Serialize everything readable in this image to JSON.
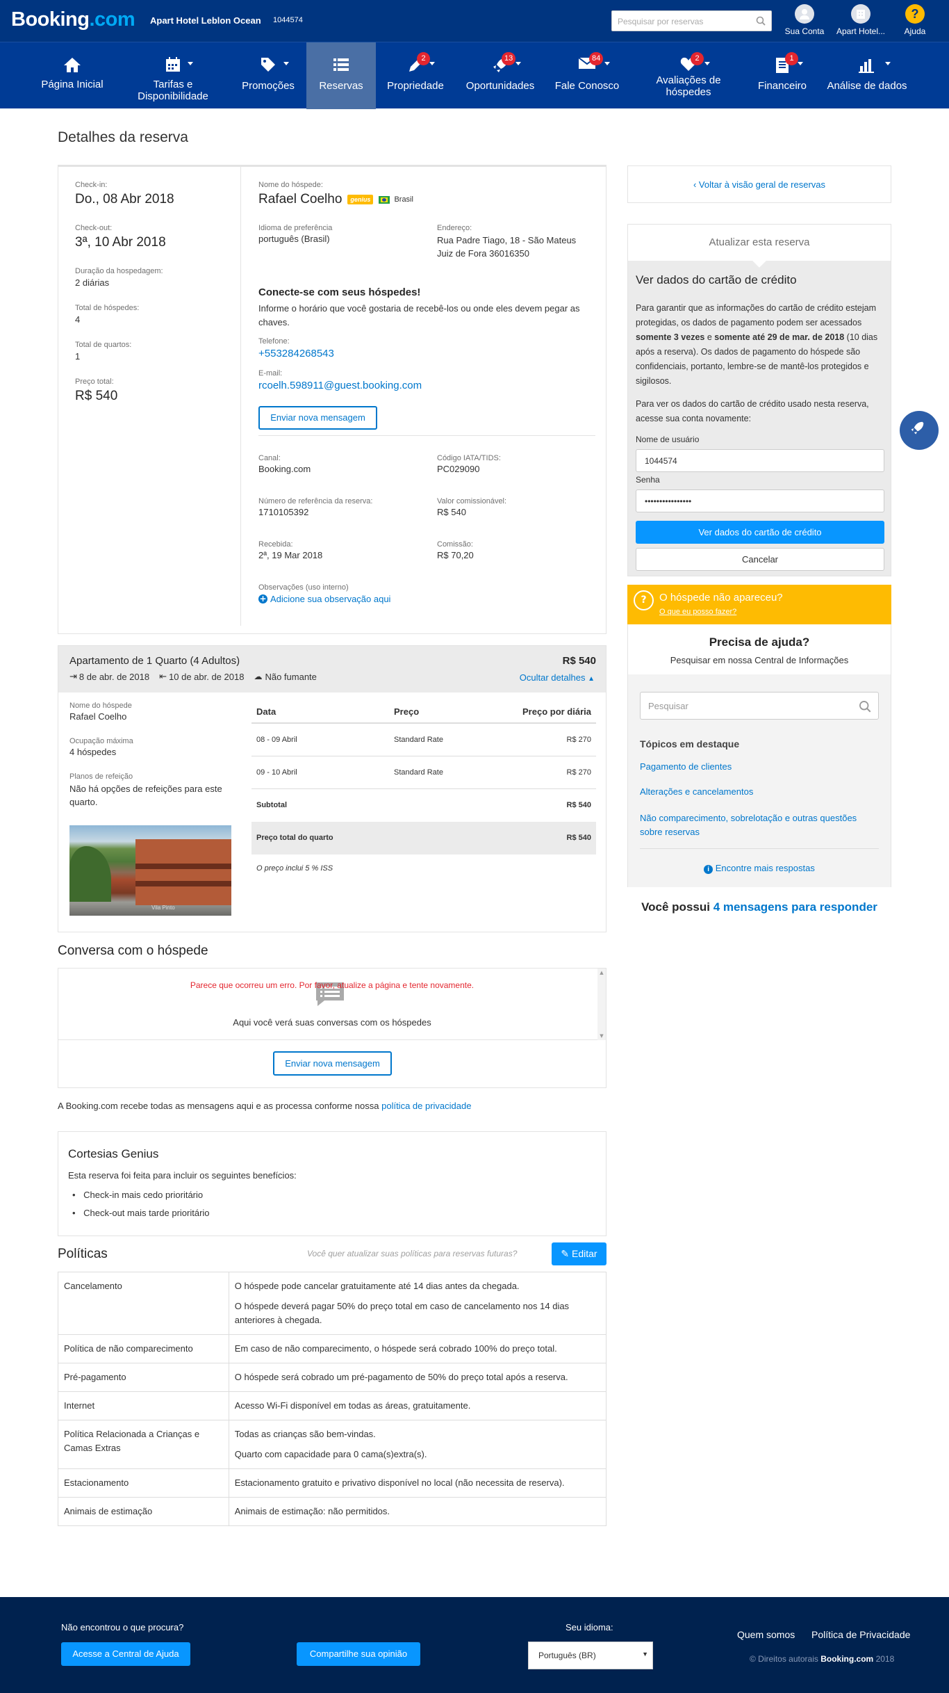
{
  "topbar": {
    "logo_text": "Booking",
    "logo_dot": ".com",
    "hotel_name": "Apart Hotel Leblon Ocean",
    "hotel_id": "1044574",
    "search_placeholder": "Pesquisar por reservas",
    "account_label": "Sua Conta",
    "hotel_label": "Apart Hotel...",
    "help_label": "Ajuda"
  },
  "nav": [
    {
      "label": "Página Inicial",
      "icon": "home-icon"
    },
    {
      "label": "Tarifas e Disponibilidade",
      "icon": "calendar-icon"
    },
    {
      "label": "Promoções",
      "icon": "tag-icon"
    },
    {
      "label": "Reservas",
      "icon": "list-icon"
    },
    {
      "label": "Propriedade",
      "icon": "pencil-icon",
      "badge": "2"
    },
    {
      "label": "Oportunidades",
      "icon": "rocket-icon",
      "badge": "13"
    },
    {
      "label": "Fale Conosco",
      "icon": "mail-icon",
      "badge": "84"
    },
    {
      "label": "Avaliações de hóspedes",
      "icon": "heart-icon",
      "badge": "2"
    },
    {
      "label": "Financeiro",
      "icon": "document-icon",
      "badge": "1"
    },
    {
      "label": "Análise de dados",
      "icon": "bar-chart-icon"
    }
  ],
  "page_title": "Detalhes da reserva",
  "stay": {
    "checkin_label": "Check-in:",
    "checkin": "Do., 08 Abr 2018",
    "checkout_label": "Check-out:",
    "checkout": "3ª, 10 Abr 2018",
    "duration_label": "Duração da hospedagem:",
    "duration": "2 diárias",
    "guests_label": "Total de hóspedes:",
    "guests": "4",
    "rooms_label": "Total de quartos:",
    "rooms": "1",
    "price_label": "Preço total:",
    "price": "R$ 540"
  },
  "guest": {
    "name_label": "Nome do hóspede:",
    "name": "Rafael Coelho",
    "genius": "genius",
    "country": "Brasil",
    "language_label": "Idioma de preferência",
    "language": "português (Brasil)",
    "address_label": "Endereço:",
    "address_line1": "Rua Padre Tiago, 18 - São Mateus",
    "address_line2": "Juiz de Fora 36016350",
    "connect_title": "Conecte-se com seus hóspedes!",
    "connect_text": "Informe o horário que você gostaria de recebê-los ou onde eles devem pegar as chaves.",
    "phone_label": "Telefone:",
    "phone": "+553284268543",
    "email_label": "E-mail:",
    "email": "rcoelh.598911@guest.booking.com",
    "send_message": "Enviar nova mensagem"
  },
  "booking": {
    "channel_label": "Canal:",
    "channel": "Booking.com",
    "iata_label": "Código IATA/TIDS:",
    "iata": "PC029090",
    "ref_label": "Número de referência da reserva:",
    "ref": "1710105392",
    "commissionable_label": "Valor comissionável:",
    "commissionable": "R$ 540",
    "received_label": "Recebida:",
    "received": "2ª, 19 Mar 2018",
    "commission_label": "Comissão:",
    "commission": "R$ 70,20",
    "notes_label": "Observações (uso interno)",
    "add_note": "Adicione sua observação aqui"
  },
  "room": {
    "title": "Apartamento de 1 Quarto (4 Adultos)",
    "price": "R$ 540",
    "checkin": "8 de abr. de 2018",
    "checkout": "10 de abr. de 2018",
    "smoking": "Não fumante",
    "hide_details": "Ocultar detalhes",
    "guest_label": "Nome do hóspede",
    "guest": "Rafael Coelho",
    "occupancy_label": "Ocupação máxima",
    "occupancy": "4 hóspedes",
    "meal_label": "Planos de refeição",
    "meal": "Não há opções de refeições para este quarto.",
    "photo_caption": "Vila Pinto",
    "table_headers": [
      "Data",
      "Preço",
      "Preço por diária"
    ],
    "rows": [
      {
        "date": "08 - 09 Abril",
        "rate": "Standard Rate",
        "price": "R$ 270"
      },
      {
        "date": "09 - 10 Abril",
        "rate": "Standard Rate",
        "price": "R$ 270"
      }
    ],
    "subtotal_label": "Subtotal",
    "subtotal": "R$ 540",
    "total_label": "Preço total do quarto",
    "total": "R$ 540",
    "tax_note": "O preço inclui 5 % ISS"
  },
  "conversation": {
    "title": "Conversa com o hóspede",
    "error": "Parece que ocorreu um erro. Por favor, atualize a página e tente novamente.",
    "empty": "Aqui você verá suas conversas com os hóspedes",
    "send": "Enviar nova mensagem",
    "privacy_text": "A Booking.com recebe todas as mensagens aqui e as processa conforme nossa ",
    "privacy_link": "política de privacidade"
  },
  "genius": {
    "title": "Cortesias Genius",
    "intro": "Esta reserva foi feita para incluir os seguintes benefícios:",
    "items": [
      "Check-in mais cedo prioritário",
      "Check-out mais tarde prioritário"
    ]
  },
  "policies": {
    "title": "Políticas",
    "prompt": "Você quer atualizar suas políticas para reservas futuras?",
    "edit": "Editar",
    "rows": [
      {
        "name": "Cancelamento",
        "lines": [
          "O hóspede pode cancelar gratuitamente até 14 dias antes da chegada.",
          "O hóspede deverá pagar 50% do preço total em caso de cancelamento nos 14 dias anteriores à chegada."
        ]
      },
      {
        "name": "Política de não comparecimento",
        "lines": [
          "Em caso de não comparecimento, o hóspede será cobrado 100% do preço total."
        ]
      },
      {
        "name": "Pré-pagamento",
        "lines": [
          "O hóspede será cobrado um pré-pagamento de 50% do preço total após a reserva."
        ]
      },
      {
        "name": "Internet",
        "lines": [
          "Acesso Wi-Fi disponível em todas as áreas, gratuitamente."
        ]
      },
      {
        "name": "Política Relacionada a Crianças e Camas Extras",
        "lines": [
          "Todas as crianças são bem-vindas.",
          "Quarto com capacidade para 0 cama(s)extra(s)."
        ]
      },
      {
        "name": "Estacionamento",
        "lines": [
          "Estacionamento gratuito e privativo disponível no local (não necessita de reserva)."
        ]
      },
      {
        "name": "Animais de estimação",
        "lines": [
          "Animais de estimação: não permitidos."
        ]
      }
    ]
  },
  "sidebar": {
    "back": "Voltar à visão geral de reservas",
    "update_tab": "Atualizar esta reserva",
    "card_title": "Ver dados do cartão de crédito",
    "card_p1_a": "Para garantir que as informações do cartão de crédito estejam protegidas, os dados de pagamento podem ser acessados ",
    "card_p1_b": "somente 3 vezes",
    "card_p1_c": " e ",
    "card_p1_d": "somente até 29 de mar. de 2018",
    "card_p1_e": " (10 dias após a reserva). Os dados de pagamento do hóspede são confidenciais, portanto, lembre-se de mantê-los protegidos e sigilosos.",
    "card_p2": "Para ver os dados do cartão de crédito usado nesta reserva, acesse sua conta novamente:",
    "username_label": "Nome de usuário",
    "username": "1044574",
    "password_label": "Senha",
    "password": "••••••••••••••••",
    "view_button": "Ver dados do cartão de crédito",
    "cancel": "Cancelar",
    "noshow_title": "O hóspede não apareceu?",
    "noshow_link": "O que eu posso fazer?",
    "help_title": "Precisa de ajuda?",
    "help_sub": "Pesquisar em nossa Central de Informações",
    "help_search_placeholder": "Pesquisar",
    "topics_title": "Tópicos em destaque",
    "topics": [
      "Pagamento de clientes",
      "Alterações e cancelamentos",
      "Não comparecimento, sobrelotação e outras questões sobre reservas"
    ],
    "more": "Encontre mais respostas",
    "messages_a": "Você possui ",
    "messages_b": "4 mensagens para responder"
  },
  "footer": {
    "not_found": "Não encontrou o que procura?",
    "help_center": "Acesse a Central de Ajuda",
    "share": "Compartilhe sua opinião",
    "language_label": "Seu idioma:",
    "language": "Português (BR)",
    "about": "Quem somos",
    "privacy": "Política de Privacidade",
    "copyright_a": "© Direitos autorais ",
    "copyright_brand": "Booking.com",
    "copyright_year": " 2018"
  },
  "colors": {
    "brand": "#003580",
    "nav": "#003b95",
    "accent": "#0896ff",
    "link": "#0077cc",
    "warning": "#febb02",
    "badge": "#e3262f"
  }
}
